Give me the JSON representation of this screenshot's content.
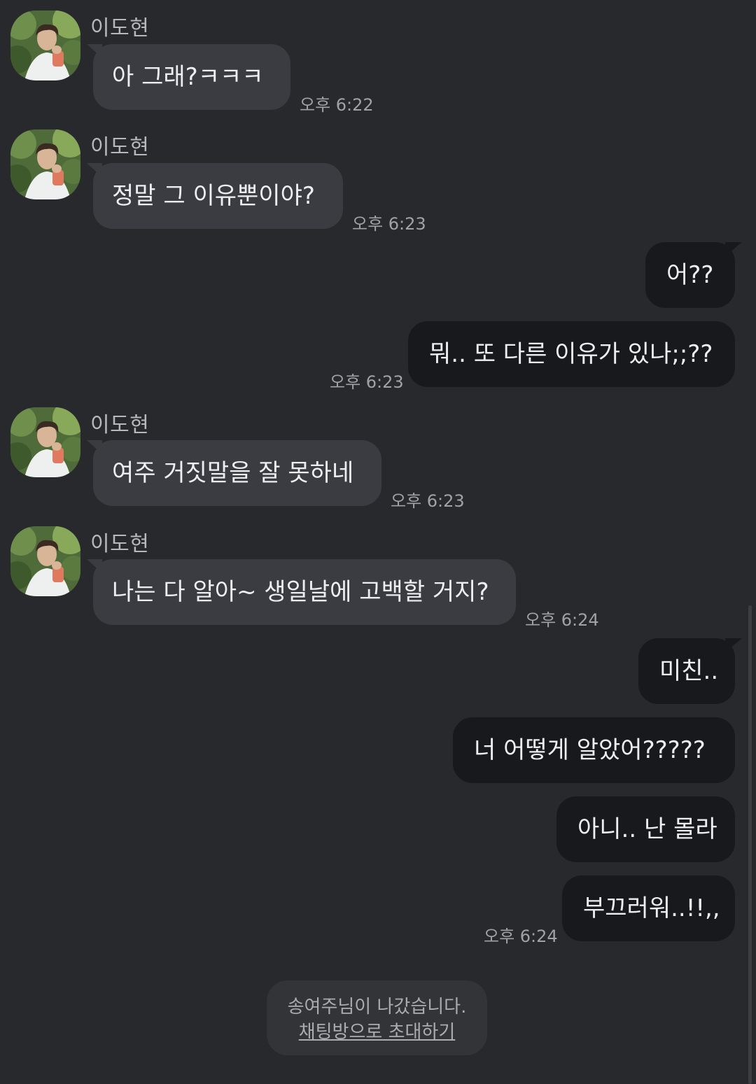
{
  "sender_name": "이도현",
  "messages": [
    {
      "text": "아 그래?ㅋㅋㅋ",
      "time": "오후 6:22"
    },
    {
      "text": "정말 그 이유뿐이야?",
      "time": "오후 6:23"
    },
    {
      "text": "어??"
    },
    {
      "text": "뭐.. 또 다른 이유가 있나;;??",
      "time": "오후 6:23"
    },
    {
      "text": "여주 거짓말을 잘 못하네",
      "time": "오후 6:23"
    },
    {
      "text": "나는 다 알아~ 생일날에 고백할 거지?",
      "time": "오후 6:24"
    },
    {
      "text": "미친.."
    },
    {
      "text": "너 어떻게 알았어?????"
    },
    {
      "text": "아니.. 난 몰라"
    },
    {
      "text": "부끄러워..!!,,",
      "time": "오후 6:24"
    }
  ],
  "notice": {
    "text": "송여주님이 나갔습니다.",
    "link": "채팅방으로 초대하기"
  },
  "colors": {
    "background": "#27292d",
    "incoming_bubble": "#3a3c41",
    "outgoing_bubble": "#18191c"
  }
}
